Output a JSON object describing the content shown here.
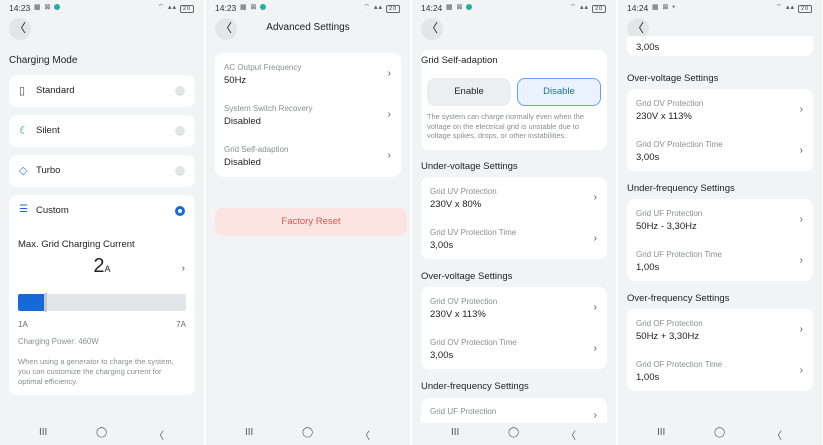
{
  "status": [
    {
      "time": "14:23",
      "battery": "20"
    },
    {
      "time": "14:23",
      "battery": "20"
    },
    {
      "time": "14:24",
      "battery": "20"
    },
    {
      "time": "14:24",
      "battery": "20"
    }
  ],
  "nav_icons": [
    "recents-icon",
    "home-icon",
    "back-icon"
  ],
  "nav_glyphs": [
    "III",
    "◯",
    "〈"
  ],
  "panel1": {
    "section_title": "Charging Mode",
    "modes": [
      {
        "label": "Standard",
        "icon": "battery-icon",
        "selected": false
      },
      {
        "label": "Silent",
        "icon": "moon-icon",
        "selected": false
      },
      {
        "label": "Turbo",
        "icon": "diamond-icon",
        "selected": false
      },
      {
        "label": "Custom",
        "icon": "sliders-icon",
        "selected": true
      }
    ],
    "custom": {
      "title": "Max. Grid Charging Current",
      "value": "2",
      "unit": "A",
      "slider_fraction": 0.16,
      "min_label": "1A",
      "max_label": "7A",
      "power": "Charging Power: 460W",
      "note": "When using a generator to charge the system, you can customize the charging current for optimal efficiency."
    },
    "accent": "#1769d8"
  },
  "panel2": {
    "title": "Advanced Settings",
    "items": [
      {
        "label": "AC Output Frequency",
        "value": "50Hz"
      },
      {
        "label": "System Switch Recovery",
        "value": "Disabled"
      },
      {
        "label": "Grid Self-adaption",
        "value": "Disabled"
      }
    ],
    "factory_reset": "Factory Reset",
    "reset_bg": "#fbe4e2",
    "reset_color": "#d4584c"
  },
  "panel3": {
    "grid_title": "Grid Self-adaption",
    "enable": "Enable",
    "disable": "Disable",
    "grid_note": "The system can charge normally even when the voltage on the electrical grid is unstable due to voltage spikes, drops, or other instabilities.",
    "uv_title": "Under-voltage Settings",
    "uv_items": [
      {
        "label": "Grid UV Protection",
        "value": "230V x 80%"
      },
      {
        "label": "Grid UV Protection Time",
        "value": "3,00s"
      }
    ],
    "ov_title": "Over-voltage Settings",
    "ov_items": [
      {
        "label": "Grid OV Protection",
        "value": "230V x 113%"
      },
      {
        "label": "Grid OV Protection Time",
        "value": "3,00s"
      }
    ],
    "uf_title": "Under-frequency Settings",
    "uf_items": [
      {
        "label": "Grid UF Protection",
        "value": ""
      }
    ]
  },
  "panel4": {
    "top_value": "3,00s",
    "ov_title": "Over-voltage Settings",
    "ov_items": [
      {
        "label": "Grid OV Protection",
        "value": "230V x 113%"
      },
      {
        "label": "Grid OV Protection Time",
        "value": "3,00s"
      }
    ],
    "uf_title": "Under-frequency Settings",
    "uf_items": [
      {
        "label": "Grid UF Protection",
        "value": "50Hz - 3,30Hz"
      },
      {
        "label": "Grid UF Protection Time",
        "value": "1,00s"
      }
    ],
    "of_title": "Over-frequency Settings",
    "of_items": [
      {
        "label": "Grid OF Protection",
        "value": "50Hz + 3,30Hz"
      },
      {
        "label": "Grid OF Protection Time",
        "value": "1,00s"
      }
    ]
  }
}
